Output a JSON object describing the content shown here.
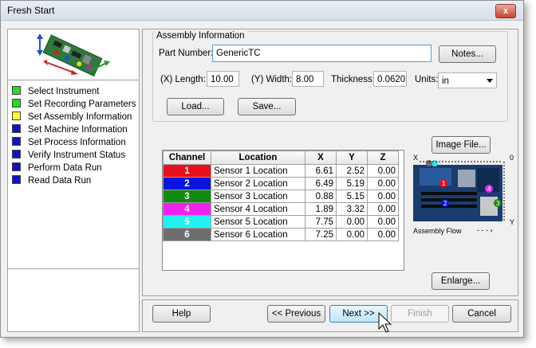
{
  "window": {
    "title": "Fresh Start",
    "close_label": "x"
  },
  "steps": [
    {
      "label": "Select Instrument",
      "color": "#22dd22"
    },
    {
      "label": "Set Recording Parameters",
      "color": "#22dd22"
    },
    {
      "label": "Set Assembly Information",
      "color": "#ffff22"
    },
    {
      "label": "Set Machine Information",
      "color": "#1010cc"
    },
    {
      "label": "Set Process Information",
      "color": "#1010cc"
    },
    {
      "label": "Verify Instrument Status",
      "color": "#1010cc"
    },
    {
      "label": "Perform Data Run",
      "color": "#1010cc"
    },
    {
      "label": "Read Data Run",
      "color": "#1010cc"
    }
  ],
  "assembly": {
    "group_label": "Assembly Information",
    "part_number_label": "Part Number:",
    "part_number_value": "GenericTC",
    "notes_button": "Notes...",
    "length_label": "(X) Length:",
    "length_value": "10.00",
    "width_label": "(Y) Width:",
    "width_value": "8.00",
    "thickness_label": "Thickness:",
    "thickness_value": "0.0620",
    "units_label": "Units:",
    "units_value": "in",
    "load_button": "Load...",
    "save_button": "Save..."
  },
  "image_file_button": "Image File...",
  "enlarge_button": "Enlarge...",
  "board_thumbnail": {
    "x_label": "X",
    "y_label": "Y",
    "zero_label": "0",
    "flow_label": "Assembly Flow",
    "markers": [
      "1",
      "2",
      "3",
      "4"
    ]
  },
  "table": {
    "headers": [
      "Channel",
      "Location",
      "X",
      "Y",
      "Z"
    ],
    "rows": [
      {
        "channel": "1",
        "color": "#e8101c",
        "location": "Sensor 1 Location",
        "x": "6.61",
        "y": "2.52",
        "z": "0.00"
      },
      {
        "channel": "2",
        "color": "#0a14e0",
        "location": "Sensor 2 Location",
        "x": "6.49",
        "y": "5.19",
        "z": "0.00"
      },
      {
        "channel": "3",
        "color": "#128a12",
        "location": "Sensor 3 Location",
        "x": "0.88",
        "y": "5.15",
        "z": "0.00"
      },
      {
        "channel": "4",
        "color": "#ee22ee",
        "location": "Sensor 4 Location",
        "x": "1.89",
        "y": "3.32",
        "z": "0.00"
      },
      {
        "channel": "5",
        "color": "#20f0f0",
        "location": "Sensor 5 Location",
        "x": "7.75",
        "y": "0.00",
        "z": "0.00"
      },
      {
        "channel": "6",
        "color": "#6e6e6e",
        "location": "Sensor 6 Location",
        "x": "7.25",
        "y": "0.00",
        "z": "0.00"
      }
    ]
  },
  "footer": {
    "help": "Help",
    "previous": "<< Previous",
    "next": "Next >>",
    "finish": "Finish",
    "cancel": "Cancel"
  }
}
